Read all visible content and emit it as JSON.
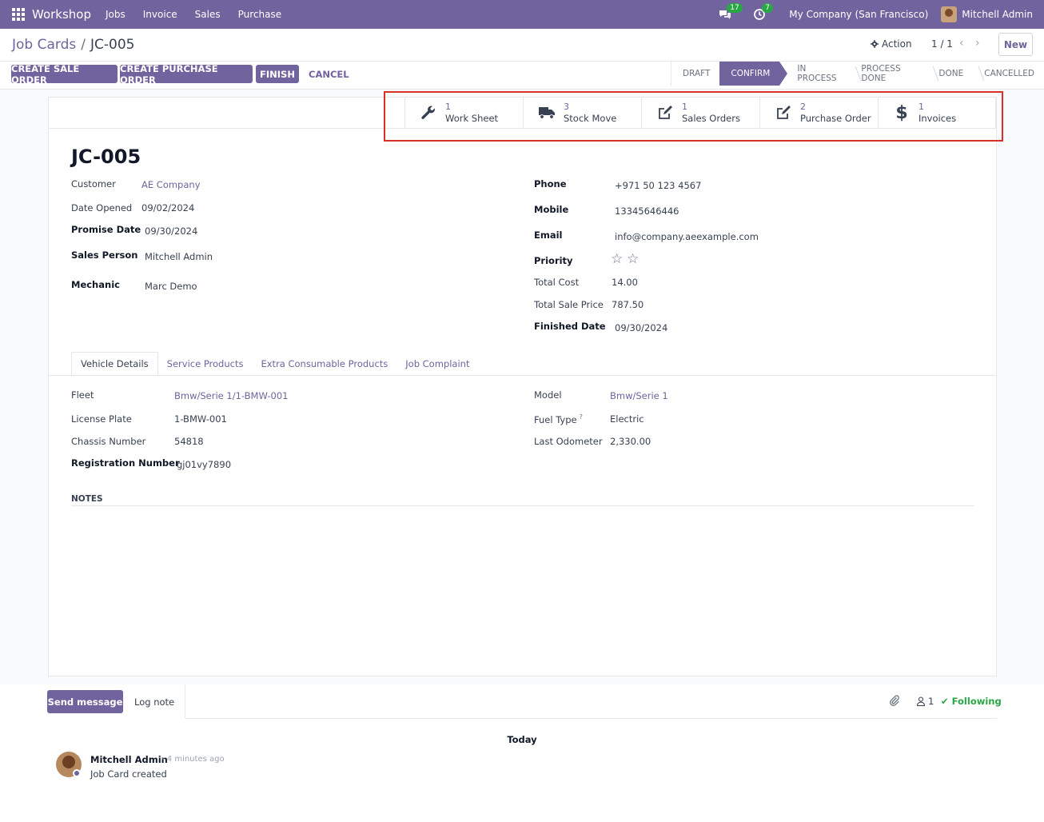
{
  "navbar": {
    "brand": "Workshop",
    "menus": [
      "Jobs",
      "Invoice",
      "Sales",
      "Purchase"
    ],
    "messages_count": "17",
    "activities_count": "7",
    "company": "My Company (San Francisco)",
    "user": "Mitchell Admin"
  },
  "control_panel": {
    "breadcrumb_parent": "Job Cards",
    "breadcrumb_sep": "/",
    "breadcrumb_current": "JC-005",
    "action_label": "Action",
    "pager": "1 / 1",
    "new_label": "New",
    "buttons": {
      "create_sale_order": "CREATE SALE ORDER",
      "create_purchase_order": "CREATE PURCHASE ORDER",
      "finish": "FINISH",
      "cancel": "CANCEL"
    },
    "stages": [
      "DRAFT",
      "CONFIRM",
      "IN PROCESS",
      "PROCESS DONE",
      "DONE",
      "CANCELLED"
    ],
    "active_stage": "CONFIRM"
  },
  "smart_buttons": [
    {
      "value": "1",
      "label": "Work Sheet",
      "icon": "wrench-icon"
    },
    {
      "value": "3",
      "label": "Stock Move",
      "icon": "truck-icon"
    },
    {
      "value": "1",
      "label": "Sales Orders",
      "icon": "edit-icon"
    },
    {
      "value": "2",
      "label": "Purchase Order",
      "icon": "edit-icon"
    },
    {
      "value": "1",
      "label": "Invoices",
      "icon": "dollar-icon"
    }
  ],
  "record": {
    "name": "JC-005",
    "left": {
      "customer_label": "Customer",
      "customer": "AE Company",
      "date_opened_label": "Date Opened",
      "date_opened": "09/02/2024",
      "promise_date_label": "Promise Date",
      "promise_date": "09/30/2024",
      "sales_person_label": "Sales Person",
      "sales_person": "Mitchell Admin",
      "mechanic_label": "Mechanic",
      "mechanic": "Marc Demo"
    },
    "right": {
      "phone_label": "Phone",
      "phone": "+971 50 123 4567",
      "mobile_label": "Mobile",
      "mobile": "13345646446",
      "email_label": "Email",
      "email": "info@company.aeexample.com",
      "priority_label": "Priority",
      "priority_stars": 0,
      "total_cost_label": "Total Cost",
      "total_cost": "14.00",
      "total_sale_price_label": "Total Sale Price",
      "total_sale_price": "787.50",
      "finished_date_label": "Finished Date",
      "finished_date": "09/30/2024"
    }
  },
  "tabs": [
    "Vehicle Details",
    "Service Products",
    "Extra Consumable Products",
    "Job Complaint"
  ],
  "vehicle": {
    "fleet_label": "Fleet",
    "fleet": "Bmw/Serie 1/1-BMW-001",
    "license_plate_label": "License Plate",
    "license_plate": "1-BMW-001",
    "chassis_label": "Chassis Number",
    "chassis": "54818",
    "registration_label": "Registration Number",
    "registration": "gj01vy7890",
    "model_label": "Model",
    "model": "Bmw/Serie 1",
    "fuel_type_label": "Fuel Type",
    "fuel_type_help": "?",
    "fuel_type": "Electric",
    "last_odometer_label": "Last Odometer",
    "last_odometer": "2,330.00"
  },
  "notes_label": "NOTES",
  "chatter": {
    "send_message": "Send message",
    "log_note": "Log note",
    "followers_count": "1",
    "following": "Following",
    "today": "Today",
    "message": {
      "author": "Mitchell Admin",
      "time": "- 4 minutes ago",
      "body": "Job Card created"
    }
  },
  "colors": {
    "brand": "#71639e",
    "highlight": "#d93025",
    "success": "#28a745"
  }
}
